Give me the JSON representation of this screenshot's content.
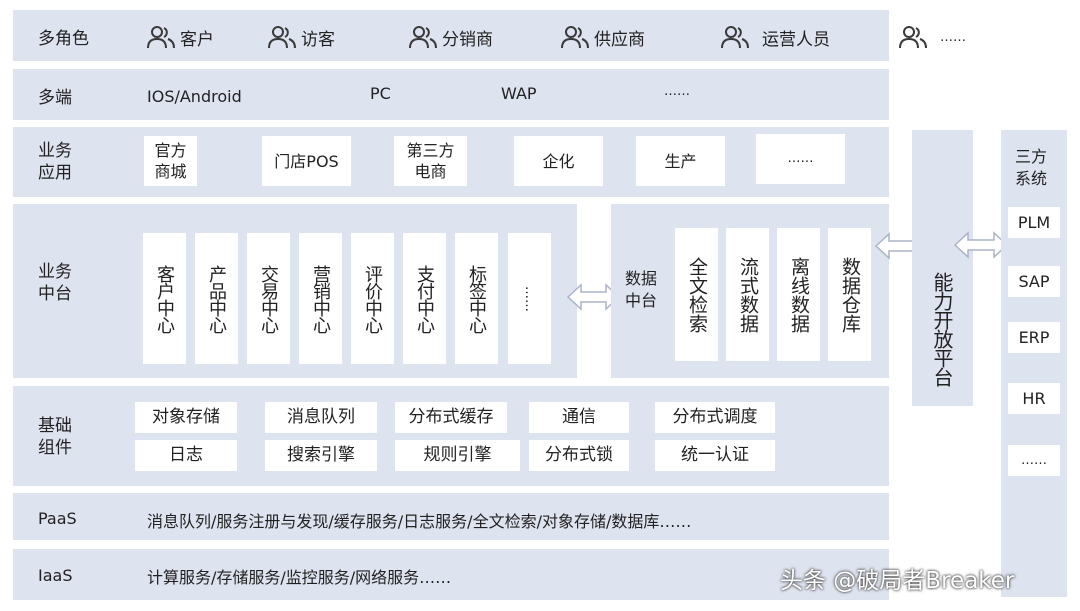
{
  "colors": {
    "band": "#dde3ef",
    "box": "#ffffff",
    "text": "#222222",
    "icon": "#3a3a3a"
  },
  "roles": {
    "label": "多角色",
    "items": [
      "客户",
      "访客",
      "分销商",
      "供应商",
      "运营人员",
      "……"
    ]
  },
  "clients": {
    "label": "多端",
    "items": [
      "IOS/Android",
      "PC",
      "WAP",
      "……"
    ]
  },
  "business_apps": {
    "label_line1": "业务",
    "label_line2": "应用",
    "items": [
      {
        "line1": "官方",
        "line2": "商城"
      },
      {
        "line1": "门店POS",
        "line2": ""
      },
      {
        "line1": "第三方",
        "line2": "电商"
      },
      {
        "line1": "企化",
        "line2": ""
      },
      {
        "line1": "生产",
        "line2": ""
      },
      {
        "line1": "……",
        "line2": ""
      }
    ]
  },
  "business_middle": {
    "label_line1": "业务",
    "label_line2": "中台",
    "items": [
      "客户中心",
      "产品中心",
      "交易中心",
      "营销中心",
      "评价中心",
      "支付中心",
      "标签中心",
      "……"
    ]
  },
  "data_middle": {
    "label_line1": "数据",
    "label_line2": "中台",
    "items": [
      "全文检索",
      "流式数据",
      "离线数据",
      "数据仓库"
    ]
  },
  "open_platform": {
    "label": "能力开放平台"
  },
  "third_party": {
    "label_line1": "三方",
    "label_line2": "系统",
    "items": [
      "PLM",
      "SAP",
      "ERP",
      "HR",
      "……"
    ]
  },
  "base_components": {
    "label_line1": "基础",
    "label_line2": "组件",
    "row1": [
      "对象存储",
      "消息队列",
      "分布式缓存",
      "通信",
      "分布式调度"
    ],
    "row2": [
      "日志",
      "搜索引擎",
      "规则引擎",
      "分布式锁",
      "统一认证"
    ]
  },
  "paas": {
    "label": "PaaS",
    "text": "消息队列/服务注册与发现/缓存服务/日志服务/全文检索/对象存储/数据库……"
  },
  "iaas": {
    "label": "IaaS",
    "text": "计算服务/存储服务/监控服务/网络服务……"
  },
  "watermark": "头条 @破局者Breaker"
}
